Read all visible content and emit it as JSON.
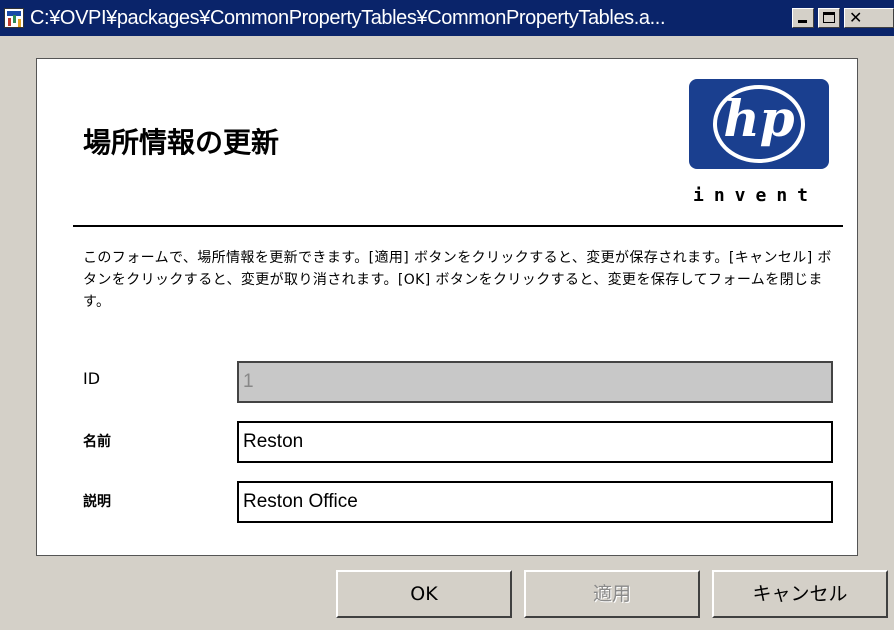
{
  "window": {
    "title": "C:¥OVPI¥packages¥CommonPropertyTables¥CommonPropertyTables.a..."
  },
  "header": {
    "title": "場所情報の更新",
    "logo_text": "hp",
    "logo_tagline": "invent"
  },
  "description": "このフォームで、場所情報を更新できます。[適用] ボタンをクリックすると、変更が保存されます。[キャンセル] ボタンをクリックすると、変更が取り消されます。[OK] ボタンをクリックすると、変更を保存してフォームを閉じます。",
  "form": {
    "fields": [
      {
        "label": "ID",
        "value": "1",
        "disabled": true
      },
      {
        "label": "名前",
        "value": "Reston",
        "disabled": false
      },
      {
        "label": "説明",
        "value": "Reston Office",
        "disabled": false
      }
    ]
  },
  "buttons": {
    "ok": "OK",
    "apply": "適用",
    "cancel": "キャンセル"
  },
  "colors": {
    "titlebar": "#0a246a",
    "logo": "#1a3f8f",
    "dialog_bg": "#d4d0c8"
  }
}
